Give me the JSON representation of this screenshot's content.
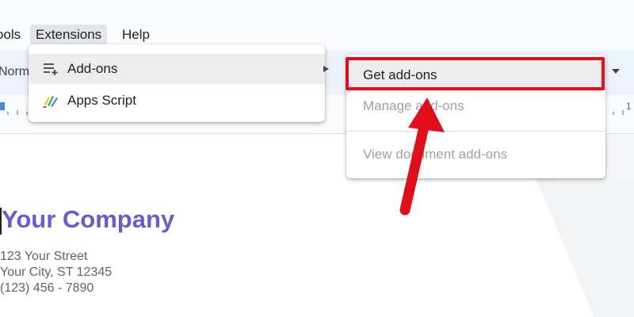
{
  "menubar": {
    "tools_label": "ools",
    "extensions_label": "Extensions",
    "help_label": "Help"
  },
  "toolbar": {
    "style_value": "Norm"
  },
  "ruler": {
    "edge_number": "1"
  },
  "extensions_menu": {
    "items": [
      {
        "label": "Add-ons",
        "icon": "add-ons-icon",
        "has_submenu": true
      },
      {
        "label": "Apps Script",
        "icon": "apps-script-icon",
        "has_submenu": false
      }
    ]
  },
  "addons_submenu": {
    "items": [
      {
        "label": "Get add-ons",
        "enabled": true
      },
      {
        "label": "Manage add-ons",
        "enabled": false
      },
      {
        "label": "View document add-ons",
        "enabled": false
      }
    ]
  },
  "document": {
    "company_name": "Your Company",
    "address_street": "123 Your Street",
    "address_city": "Your City, ST 12345",
    "phone": "(123) 456 - 7890"
  },
  "colors": {
    "highlight": "#e0101a",
    "company": "#6a5acd",
    "menu_hover": "#ececec"
  }
}
